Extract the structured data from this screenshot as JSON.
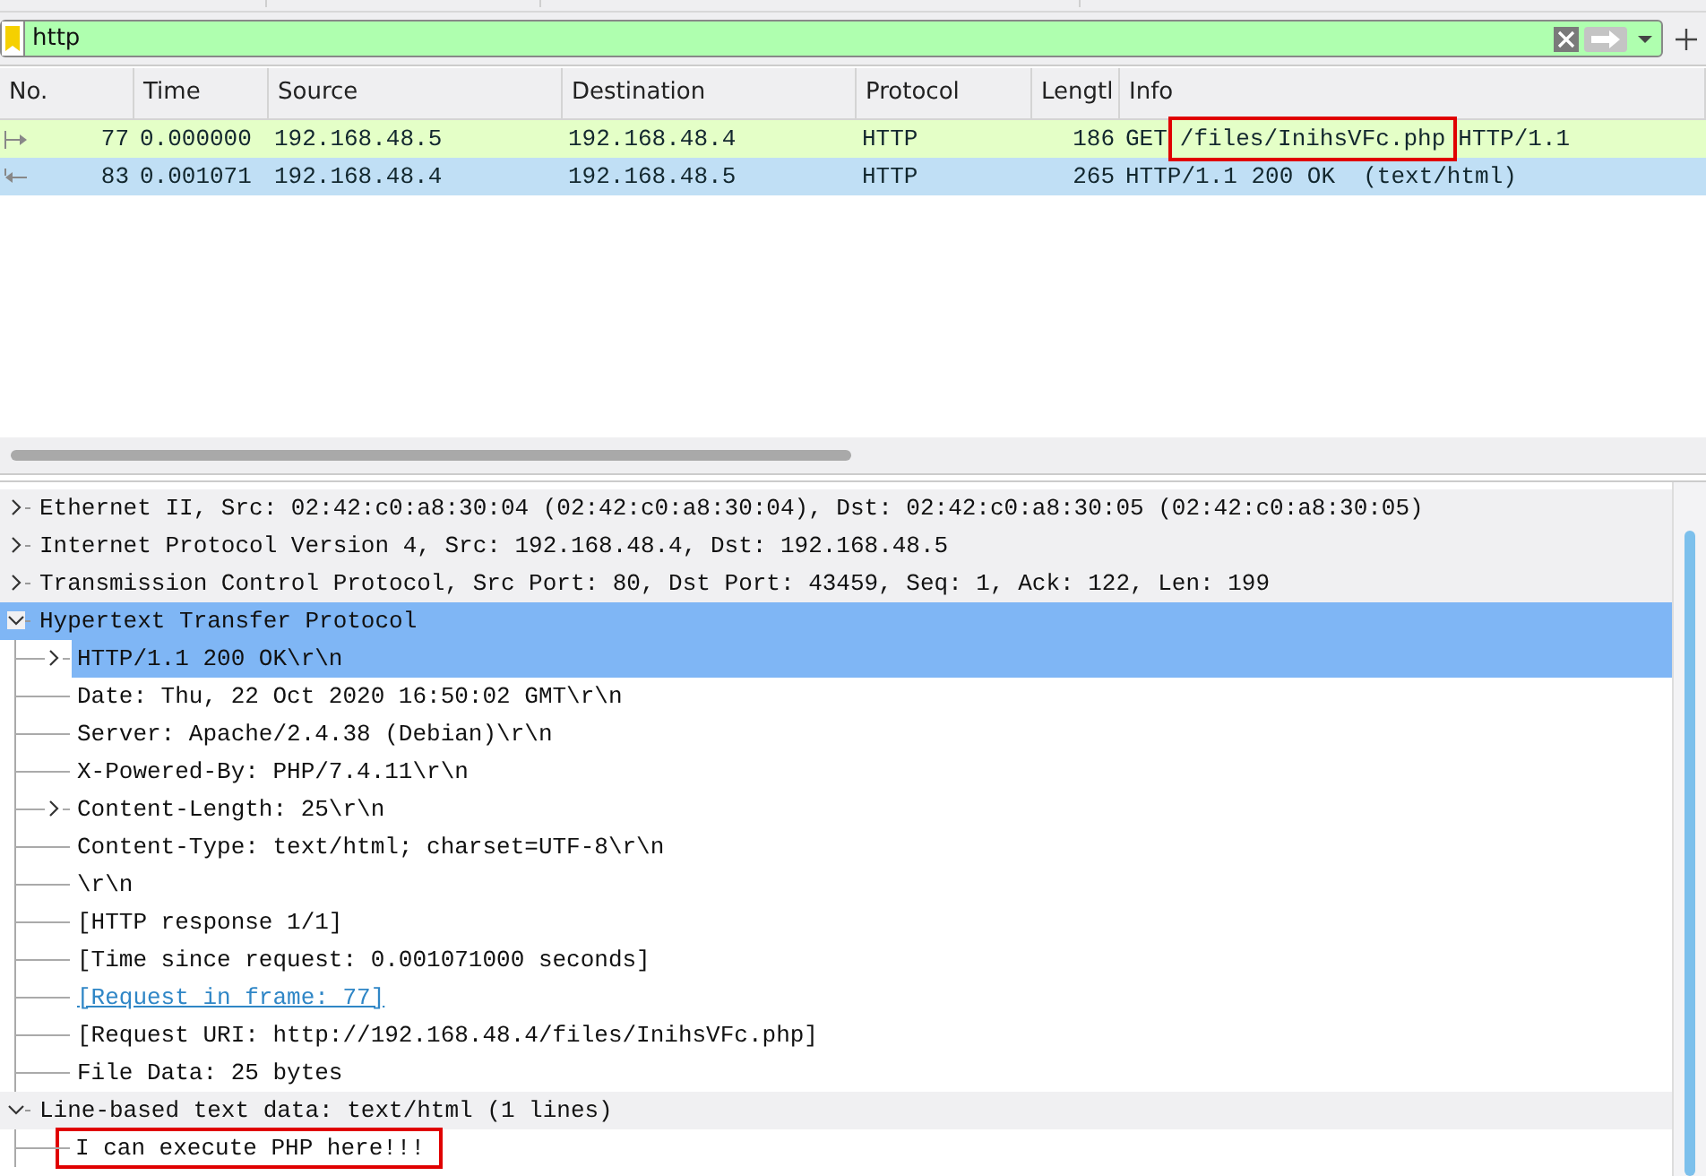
{
  "filter": {
    "value": "http",
    "valid": true
  },
  "packet_list": {
    "columns": [
      "No.",
      "Time",
      "Source",
      "Destination",
      "Protocol",
      "Lengtl",
      "Info"
    ],
    "rows": [
      {
        "kind": "request",
        "selected": false,
        "no": "77",
        "time": "0.000000",
        "source": "192.168.48.5",
        "destination": "192.168.48.4",
        "protocol": "HTTP",
        "length": "186",
        "info": [
          {
            "text": "GET",
            "boxed": false
          },
          {
            "text": "/files/InihsVFc.php",
            "boxed": true
          },
          {
            "text": "HTTP/1.1",
            "boxed": false
          }
        ]
      },
      {
        "kind": "response",
        "selected": true,
        "no": "83",
        "time": "0.001071",
        "source": "192.168.48.4",
        "destination": "192.168.48.5",
        "protocol": "HTTP",
        "length": "265",
        "info": [
          {
            "text": "HTTP/1.1 200 OK  (text/html)",
            "boxed": false
          }
        ]
      }
    ]
  },
  "details": [
    {
      "text": "Ethernet II, Src: 02:42:c0:a8:30:04 (02:42:c0:a8:30:04), Dst: 02:42:c0:a8:30:05 (02:42:c0:a8:30:05)",
      "expanded": false,
      "selected": false
    },
    {
      "text": "Internet Protocol Version 4, Src: 192.168.48.4, Dst: 192.168.48.5",
      "expanded": false,
      "selected": false
    },
    {
      "text": "Transmission Control Protocol, Src Port: 80, Dst Port: 43459, Seq: 1, Ack: 122, Len: 199",
      "expanded": false,
      "selected": false
    },
    {
      "text": "Hypertext Transfer Protocol",
      "expanded": true,
      "selected": true,
      "children": [
        {
          "text": "HTTP/1.1 200 OK\\r\\n",
          "expanded": false,
          "selected": true
        },
        {
          "text": "Date: Thu, 22 Oct 2020 16:50:02 GMT\\r\\n",
          "selected": false
        },
        {
          "text": "Server: Apache/2.4.38 (Debian)\\r\\n",
          "selected": false
        },
        {
          "text": "X-Powered-By: PHP/7.4.11\\r\\n",
          "selected": false
        },
        {
          "text": "Content-Length: 25\\r\\n",
          "expanded": false,
          "selected": false
        },
        {
          "text": "Content-Type: text/html; charset=UTF-8\\r\\n",
          "selected": false
        },
        {
          "text": "\\r\\n",
          "selected": false
        },
        {
          "text": "[HTTP response 1/1]",
          "selected": false
        },
        {
          "text": "[Time since request: 0.001071000 seconds]",
          "selected": false
        },
        {
          "text": "[Request in frame: 77]",
          "kind": "link",
          "selected": false
        },
        {
          "text": "[Request URI: http://192.168.48.4/files/InihsVFc.php]",
          "selected": false
        },
        {
          "text": "File Data: 25 bytes",
          "selected": false
        }
      ]
    },
    {
      "text": "Line-based text data: text/html (1 lines)",
      "expanded": true,
      "selected": false,
      "children": [
        {
          "text": "I can execute PHP here!!!",
          "boxed": true,
          "selected": false
        }
      ]
    }
  ]
}
